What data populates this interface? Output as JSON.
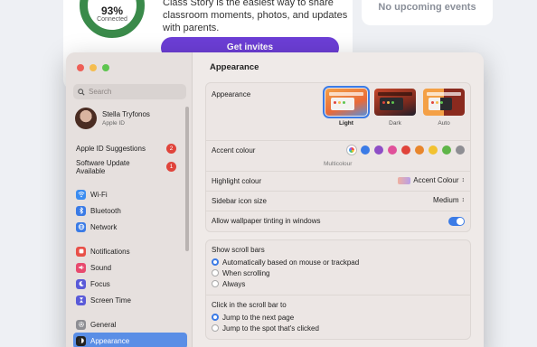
{
  "background": {
    "ring_percent": "93%",
    "ring_label": "Connected",
    "text": "Class Story is the easiest way to share classroom moments, photos, and updates with parents.",
    "button_label": "Get invites",
    "events_label": "No upcoming events"
  },
  "sidebar": {
    "search_placeholder": "Search",
    "profile": {
      "name": "Stella Tryfonos",
      "subtitle": "Apple ID"
    },
    "notices": [
      {
        "label": "Apple ID Suggestions",
        "badge": "2"
      },
      {
        "label": "Software Update Available",
        "badge": "1"
      }
    ],
    "group1": [
      {
        "label": "Wi-Fi",
        "icon": "wifi-icon",
        "color": "#3b8cf0"
      },
      {
        "label": "Bluetooth",
        "icon": "bluetooth-icon",
        "color": "#3b7be6"
      },
      {
        "label": "Network",
        "icon": "globe-icon",
        "color": "#3b7be6"
      }
    ],
    "group2": [
      {
        "label": "Notifications",
        "icon": "bell-icon",
        "color": "#e85048"
      },
      {
        "label": "Sound",
        "icon": "speaker-icon",
        "color": "#e84a6e"
      },
      {
        "label": "Focus",
        "icon": "moon-icon",
        "color": "#5a5ad8"
      },
      {
        "label": "Screen Time",
        "icon": "hourglass-icon",
        "color": "#5a5ad8"
      }
    ],
    "group3": [
      {
        "label": "General",
        "icon": "gear-icon",
        "color": "#8e8e93"
      },
      {
        "label": "Appearance",
        "icon": "appearance-icon",
        "color": "#222222"
      }
    ]
  },
  "main": {
    "title": "Appearance",
    "appearance": {
      "label": "Appearance",
      "options": [
        {
          "label": "Light",
          "selected": true
        },
        {
          "label": "Dark",
          "selected": false
        },
        {
          "label": "Auto",
          "selected": false
        }
      ]
    },
    "accent": {
      "label": "Accent colour",
      "caption": "Multicolour",
      "colors": [
        "#3b7be6",
        "#8e4ec6",
        "#e0509a",
        "#e0443b",
        "#e8862c",
        "#f2c230",
        "#5fb548",
        "#8e8e93"
      ]
    },
    "highlight": {
      "label": "Highlight colour",
      "value": "Accent Colour"
    },
    "sidebar_icon": {
      "label": "Sidebar icon size",
      "value": "Medium"
    },
    "tinting": {
      "label": "Allow wallpaper tinting in windows",
      "enabled": true
    },
    "scroll_bars": {
      "title": "Show scroll bars",
      "options": [
        {
          "label": "Automatically based on mouse or trackpad",
          "selected": true
        },
        {
          "label": "When scrolling",
          "selected": false
        },
        {
          "label": "Always",
          "selected": false
        }
      ]
    },
    "click_scroll": {
      "title": "Click in the scroll bar to",
      "options": [
        {
          "label": "Jump to the next page",
          "selected": true
        },
        {
          "label": "Jump to the spot that's clicked",
          "selected": false
        }
      ]
    }
  }
}
